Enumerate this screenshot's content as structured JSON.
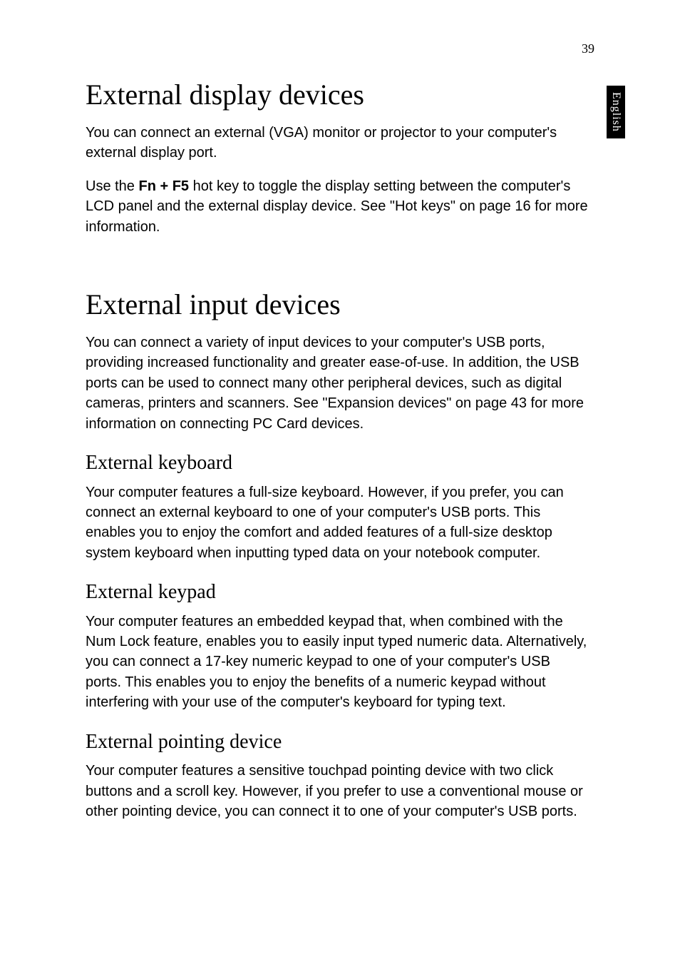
{
  "page_number": "39",
  "language_tab": "English",
  "sections": {
    "display": {
      "heading": "External display devices",
      "p1": "You can connect an external (VGA) monitor or projector to your computer's external display port.",
      "p2_a": "Use the ",
      "p2_key": "Fn + F5",
      "p2_b": " hot key to toggle the display setting between the computer's LCD panel and the external display device. See \"Hot keys\" on page 16 for more information."
    },
    "input": {
      "heading": "External input devices",
      "p1": "You can connect a variety of input devices to your computer's USB ports, providing increased functionality and greater ease-of-use. In addition, the USB ports can be used to connect many other peripheral devices, such as digital cameras, printers and scanners. See \"Expansion devices\" on page 43 for more information on connecting PC Card devices."
    },
    "keyboard": {
      "heading": "External keyboard",
      "p1": "Your computer features a full-size keyboard. However, if you prefer, you can connect an external keyboard to one of your computer's USB ports. This enables you to enjoy the comfort and added features of a full-size desktop system keyboard when inputting typed data on your notebook computer."
    },
    "keypad": {
      "heading": "External keypad",
      "p1": "Your computer features an embedded keypad that, when combined with the Num Lock feature, enables you to easily input typed numeric data. Alternatively, you can connect a 17-key numeric keypad to one of your computer's USB ports. This enables you to enjoy the benefits of a numeric keypad without interfering with your use of the computer's keyboard for typing text."
    },
    "pointing": {
      "heading": "External pointing device",
      "p1": "Your computer features a sensitive touchpad pointing device with two click buttons and a scroll key. However, if you prefer to use a conventional mouse or other pointing device, you can connect it to one of your computer's USB ports."
    }
  }
}
